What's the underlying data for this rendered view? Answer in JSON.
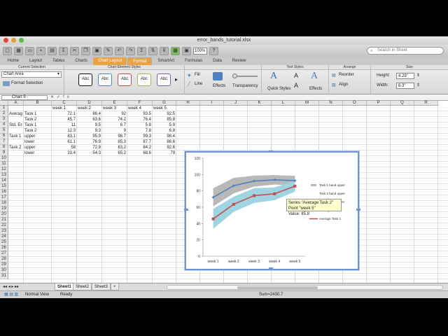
{
  "window": {
    "title": "error_bands_tutorial.xlsx"
  },
  "toolbar": {
    "zoom": "100%",
    "search_placeholder": "Search in Sheet"
  },
  "ribbon_tabs": [
    "Home",
    "Layout",
    "Tables",
    "Charts",
    "Chart Layout",
    "Format",
    "SmartArt",
    "Formulas",
    "Data",
    "Review"
  ],
  "ribbon": {
    "current_selection_header": "Current Selection",
    "current_selection": "Chart Area",
    "format_selection": "Format Selection",
    "chart_element_styles_header": "Chart Element Styles",
    "swatches": [
      "Abc",
      "Abc",
      "Abc",
      "Abc",
      "Abc"
    ],
    "fill": "Fill",
    "line": "Line",
    "effects": "Effects",
    "transparency": "Transparency",
    "text_styles_header": "Text Styles",
    "quick_styles": "Quick Styles",
    "text_effects": "Effects",
    "arrange_header": "Arrange",
    "reorder": "Reorder",
    "align": "Align",
    "size_header": "Size",
    "height_label": "Height:",
    "height_value": "4.29\"",
    "width_label": "Width:",
    "width_value": "6.3\""
  },
  "formula_bar": {
    "name_box": "Chart 5",
    "fx": "fx"
  },
  "sheet": {
    "columns": [
      "A",
      "B",
      "C",
      "D",
      "E",
      "F",
      "G",
      "H",
      "I",
      "J",
      "K",
      "L",
      "M",
      "N",
      "O",
      "P",
      "Q",
      "R"
    ],
    "rows": [
      "1",
      "2",
      "3",
      "4",
      "5",
      "6",
      "7",
      "8",
      "9",
      "10",
      "11",
      "12",
      "13",
      "14",
      "15",
      "16",
      "17",
      "18",
      "19",
      "20",
      "21",
      "22",
      "23",
      "24",
      "25",
      "26",
      "27",
      "28",
      "29",
      "30",
      "31"
    ],
    "header_row": [
      "",
      "",
      "week 1",
      "week 2",
      "week 3",
      "week 4",
      "week 5"
    ],
    "data_rows": [
      [
        "Average",
        "Task 1",
        "72.1",
        "86.4",
        "92",
        "93.5",
        "92.5"
      ],
      [
        "",
        "Task 2",
        "45.7",
        "63.6",
        "74.2",
        "76.4",
        "85.8"
      ],
      [
        "Std. Error",
        "Task 1",
        "11",
        "9.5",
        "6.7",
        "5.8",
        "5.9"
      ],
      [
        "",
        "Task 2",
        "12.3",
        "9.3",
        "9",
        "7.8",
        "6.8"
      ],
      [
        "Task 1 band",
        "upper",
        "83.1",
        "95.9",
        "98.7",
        "99.3",
        "98.4"
      ],
      [
        "",
        "lower",
        "61.1",
        "76.9",
        "85.3",
        "87.7",
        "86.6"
      ],
      [
        "Task 2 band",
        "upper",
        "58",
        "72.9",
        "83.2",
        "84.2",
        "92.6"
      ],
      [
        "",
        "lower",
        "33.4",
        "54.3",
        "65.2",
        "68.6",
        "79"
      ]
    ]
  },
  "chart_data": {
    "type": "line",
    "categories": [
      "week 1",
      "week 2",
      "week 3",
      "week 4",
      "week 5"
    ],
    "ylim": [
      0,
      120
    ],
    "yticks": [
      "0",
      "20",
      "40",
      "60",
      "80",
      "100",
      "120"
    ],
    "grid": false,
    "legend_position": "right",
    "bands": [
      {
        "name": "Task 1 band upper",
        "upper": [
          83.1,
          95.9,
          98.7,
          99.3,
          98.4
        ],
        "lower": [
          61.1,
          76.9,
          85.3,
          87.7,
          86.6
        ],
        "color": "#b8b8b8"
      },
      {
        "name": "Task 2 band lower",
        "upper": [
          58,
          72.9,
          83.2,
          84.2,
          92.6
        ],
        "lower": [
          33.4,
          54.3,
          65.2,
          68.6,
          79
        ],
        "color": "#9fd4e3"
      }
    ],
    "series": [
      {
        "name": "Average Task 1",
        "values": [
          72.1,
          86.4,
          92,
          93.5,
          92.5
        ],
        "color": "#4f81bd"
      },
      {
        "name": "Average Task 2",
        "values": [
          45.7,
          63.6,
          74.2,
          76.4,
          85.8
        ],
        "color": "#c0504d"
      }
    ],
    "legend": [
      "Task 1 band upper",
      "Task 2 band upper",
      "Task 2 band lower",
      "Average Task 1",
      "Average Task 2"
    ],
    "tooltip": {
      "line1": "Series \"Average Task 2\" Point \"week 5\"",
      "line2": "Value: 85.8"
    }
  },
  "sheet_tabs": [
    "Sheet1",
    "Sheet2",
    "Sheet3"
  ],
  "status": {
    "view": "Normal View",
    "state": "Ready",
    "sum": "Sum=2430.7"
  }
}
